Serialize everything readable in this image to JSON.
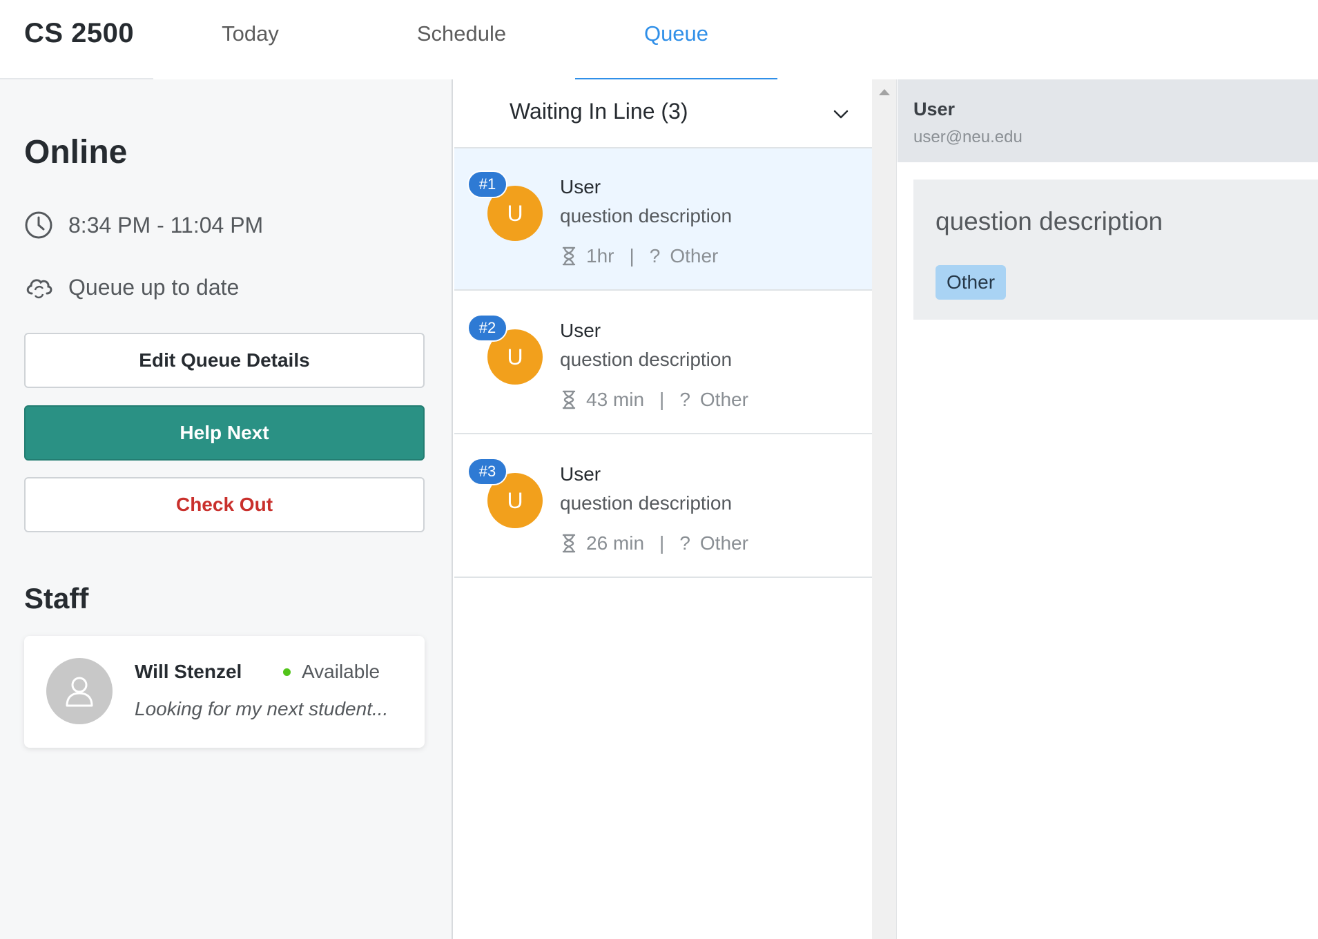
{
  "app": {
    "course_name": "CS 2500"
  },
  "nav": {
    "tabs": [
      {
        "label": "Today",
        "active": false
      },
      {
        "label": "Schedule",
        "active": false
      },
      {
        "label": "Queue",
        "active": true
      }
    ]
  },
  "sidebar": {
    "status_title": "Online",
    "time_range": "8:34 PM - 11:04 PM",
    "time_icon": "clock-icon",
    "sync_text": "Queue up to date",
    "sync_icon": "cloud-sync-icon",
    "buttons": {
      "edit": "Edit Queue Details",
      "help_next": "Help Next",
      "check_out": "Check Out"
    },
    "staff_title": "Staff",
    "staff": [
      {
        "name": "Will Stenzel",
        "status": "Available",
        "note": "Looking for my next student...",
        "avatar_icon": "user-icon"
      }
    ]
  },
  "queue": {
    "header": "Waiting In Line (3)",
    "items": [
      {
        "rank": "#1",
        "initial": "U",
        "name": "User",
        "description": "question description",
        "wait": "1hr",
        "tag": "Other",
        "selected": true
      },
      {
        "rank": "#2",
        "initial": "U",
        "name": "User",
        "description": "question description",
        "wait": "43 min",
        "tag": "Other",
        "selected": false
      },
      {
        "rank": "#3",
        "initial": "U",
        "name": "User",
        "description": "question description",
        "wait": "26 min",
        "tag": "Other",
        "selected": false
      }
    ]
  },
  "detail": {
    "name": "User",
    "email": "user@neu.edu",
    "question": "question description",
    "tag": "Other"
  },
  "colors": {
    "accent": "#2f8fe8",
    "help_button": "#2a9184",
    "check_out_text": "#c9302c",
    "avatar": "#f2a01c",
    "rank_badge": "#2e7ad4",
    "available_dot": "#52c41a",
    "tag_bg": "#a9d3f4"
  }
}
